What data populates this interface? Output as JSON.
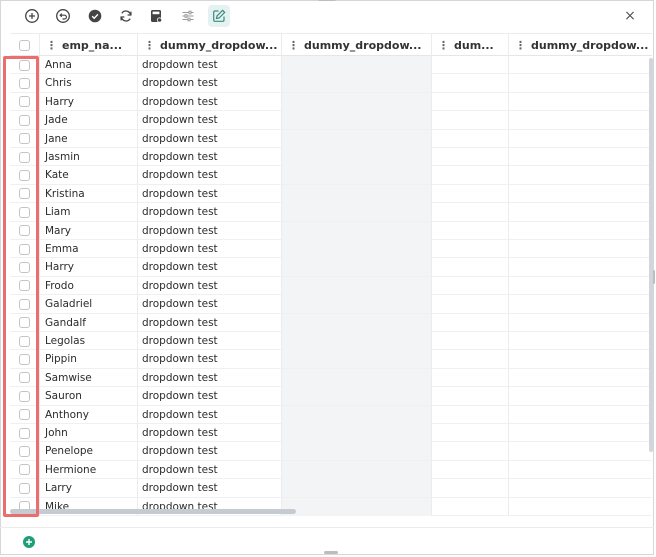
{
  "toolbar": {
    "buttons": [
      {
        "name": "add-icon"
      },
      {
        "name": "undo-icon"
      },
      {
        "name": "check-circle-icon"
      },
      {
        "name": "refresh-icon"
      },
      {
        "name": "calculator-icon"
      },
      {
        "name": "filter-sliders-icon"
      },
      {
        "name": "edit-icon"
      }
    ],
    "close_glyph": "×"
  },
  "columns": [
    {
      "label": "emp_na..."
    },
    {
      "label": "dummy_dropdow..."
    },
    {
      "label": "dummy_dropdow..."
    },
    {
      "label": "dum..."
    },
    {
      "label": "dummy_dropdow..."
    }
  ],
  "rows": [
    {
      "emp_name": "Anna",
      "dummy_dropdown": "dropdown test"
    },
    {
      "emp_name": "Chris",
      "dummy_dropdown": "dropdown test"
    },
    {
      "emp_name": "Harry",
      "dummy_dropdown": "dropdown test"
    },
    {
      "emp_name": "Jade",
      "dummy_dropdown": "dropdown test"
    },
    {
      "emp_name": "Jane",
      "dummy_dropdown": "dropdown test"
    },
    {
      "emp_name": "Jasmin",
      "dummy_dropdown": "dropdown test"
    },
    {
      "emp_name": "Kate",
      "dummy_dropdown": "dropdown test"
    },
    {
      "emp_name": "Kristina",
      "dummy_dropdown": "dropdown test"
    },
    {
      "emp_name": "Liam",
      "dummy_dropdown": "dropdown test"
    },
    {
      "emp_name": "Mary",
      "dummy_dropdown": "dropdown test"
    },
    {
      "emp_name": "Emma",
      "dummy_dropdown": "dropdown test"
    },
    {
      "emp_name": "Harry",
      "dummy_dropdown": "dropdown test"
    },
    {
      "emp_name": "Frodo",
      "dummy_dropdown": "dropdown test"
    },
    {
      "emp_name": "Galadriel",
      "dummy_dropdown": "dropdown test"
    },
    {
      "emp_name": "Gandalf",
      "dummy_dropdown": "dropdown test"
    },
    {
      "emp_name": "Legolas",
      "dummy_dropdown": "dropdown test"
    },
    {
      "emp_name": "Pippin",
      "dummy_dropdown": "dropdown test"
    },
    {
      "emp_name": "Samwise",
      "dummy_dropdown": "dropdown test"
    },
    {
      "emp_name": "Sauron",
      "dummy_dropdown": "dropdown test"
    },
    {
      "emp_name": "Anthony",
      "dummy_dropdown": "dropdown test"
    },
    {
      "emp_name": "John",
      "dummy_dropdown": "dropdown test"
    },
    {
      "emp_name": "Penelope",
      "dummy_dropdown": "dropdown test"
    },
    {
      "emp_name": "Hermione",
      "dummy_dropdown": "dropdown test"
    },
    {
      "emp_name": "Larry",
      "dummy_dropdown": "dropdown test"
    },
    {
      "emp_name": "Mike",
      "dummy_dropdown": "dropdown test"
    }
  ],
  "colors": {
    "highlight": "#ea6e6e",
    "accent": "#1f9e7a",
    "active_button_bg": "#e4f3f1",
    "shaded_column": "#f3f4f6"
  },
  "footer": {
    "add_icon": "add-row-icon"
  }
}
